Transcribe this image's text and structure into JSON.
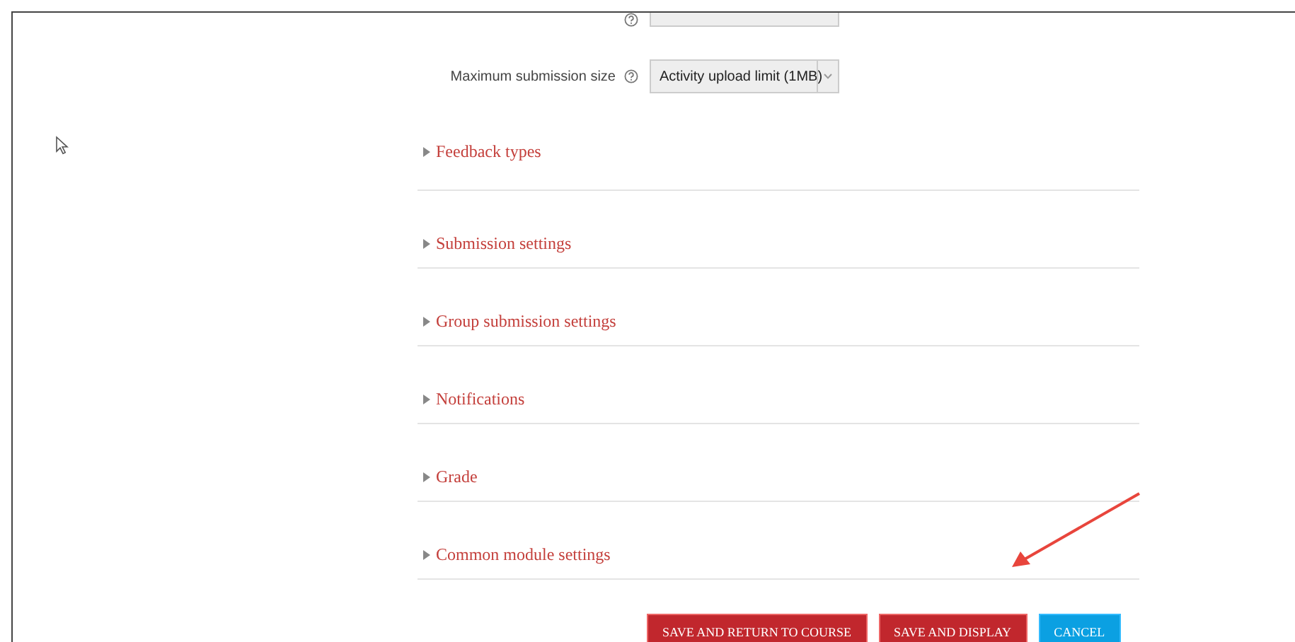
{
  "form_rows": [
    {
      "kind": "cut"
    },
    {
      "kind": "full",
      "label": "Maximum submission size",
      "select_value": "Activity upload limit (1MB)"
    }
  ],
  "sections": [
    {
      "title": "Feedback types",
      "expanded": false
    },
    {
      "title": "Submission settings",
      "expanded": false
    },
    {
      "title": "Group submission settings",
      "expanded": false
    },
    {
      "title": "Notifications",
      "expanded": false
    },
    {
      "title": "Grade",
      "expanded": false
    },
    {
      "title": "Common module settings",
      "expanded": false
    }
  ],
  "buttons": [
    {
      "label": "SAVE AND RETURN TO COURSE",
      "kind": "primary"
    },
    {
      "label": "SAVE AND DISPLAY",
      "kind": "primary"
    },
    {
      "label": "CANCEL",
      "kind": "secondary"
    }
  ]
}
